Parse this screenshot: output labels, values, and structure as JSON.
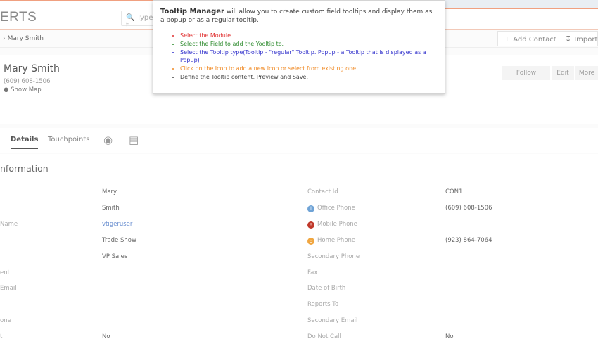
{
  "topbar": {
    "brand": "ERTS",
    "search_placeholder": "Type t"
  },
  "breadcrumb": {
    "label": "Mary Smith"
  },
  "toolbar": {
    "add_contact": "Add Contact",
    "import": "Import"
  },
  "header": {
    "name": "Mary Smith",
    "phone": "(609) 608-1506",
    "show_map": "Show Map",
    "follow": "Follow",
    "edit": "Edit",
    "more": "More"
  },
  "tabs": {
    "details": "Details",
    "touchpoints": "Touchpoints"
  },
  "section": {
    "title": "nformation"
  },
  "left_fields": [
    {
      "label": "",
      "value": "Mary"
    },
    {
      "label": "",
      "value": "Smith"
    },
    {
      "label": "Name",
      "value": "vtigeruser"
    },
    {
      "label": "",
      "value": "Trade Show"
    },
    {
      "label": "",
      "value": "VP Sales"
    },
    {
      "label": "ent",
      "value": ""
    },
    {
      "label": "Email",
      "value": ""
    },
    {
      "label": "",
      "value": ""
    },
    {
      "label": "one",
      "value": ""
    },
    {
      "label": "t",
      "value": "No"
    }
  ],
  "right_fields": [
    {
      "label": "Contact Id",
      "value": "CON1"
    },
    {
      "label": "Office Phone",
      "value": "(609) 608-1506"
    },
    {
      "label": "Mobile Phone",
      "value": ""
    },
    {
      "label": "Home Phone",
      "value": "(923) 864-7064"
    },
    {
      "label": "Secondary Phone",
      "value": ""
    },
    {
      "label": "Fax",
      "value": ""
    },
    {
      "label": "Date of Birth",
      "value": ""
    },
    {
      "label": "Reports To",
      "value": ""
    },
    {
      "label": "Secondary Email",
      "value": ""
    },
    {
      "label": "Do Not Call",
      "value": "No"
    }
  ],
  "tooltip": {
    "title": "Tooltip Manager",
    "intro": " will allow you to create custom field tooltips and display them as a popup or as a regular tooltip.",
    "steps": [
      {
        "text": "Select the Module",
        "color": "#e03030"
      },
      {
        "text": "Select the Field to add the Yooltip to.",
        "color": "#2e8b2e"
      },
      {
        "text": "Select the Tooltip type(Tooltip - \"regular\" Tooltip. Popup - a Tooltip that is displayed as a Popup)",
        "color": "#3333cc"
      },
      {
        "text": "Click on the Icon to add a new Icon or select from existing one.",
        "color": "#f08a24"
      },
      {
        "text": "Define the Tooltip content, Preview and Save.",
        "color": "#444444"
      }
    ]
  },
  "colors": {
    "office_icon": "#6fa3d6",
    "mobile_icon": "#c0392b",
    "home_icon": "#f0a640"
  }
}
